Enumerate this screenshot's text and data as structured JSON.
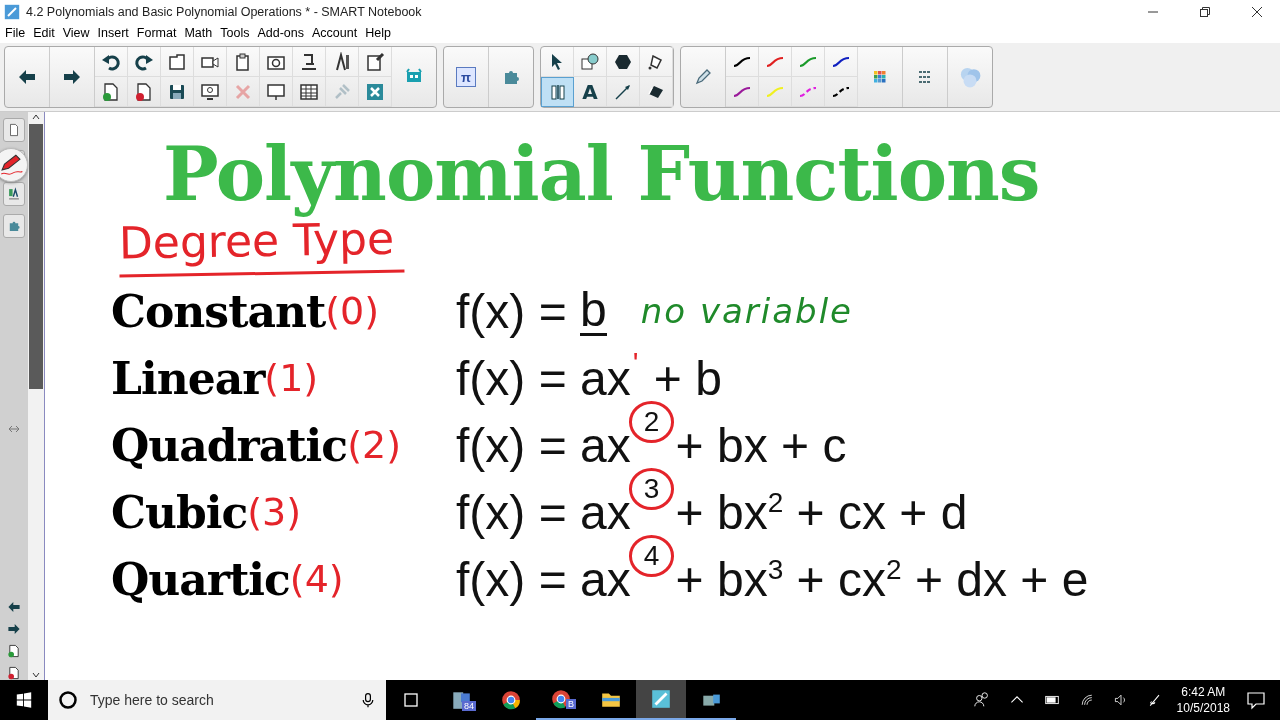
{
  "window": {
    "title": "4.2 Polynomials and Basic Polynomial Operations * - SMART Notebook"
  },
  "menu": [
    "File",
    "Edit",
    "View",
    "Insert",
    "Format",
    "Math",
    "Tools",
    "Add-ons",
    "Account",
    "Help"
  ],
  "actions": [
    {
      "disabled": false
    },
    {
      "disabled": false
    },
    {
      "disabled": false
    },
    {
      "disabled": false
    },
    {
      "disabled": false
    },
    {
      "disabled": false
    },
    {
      "disabled": false
    },
    {
      "disabled": false
    },
    {
      "disabled": false
    },
    {
      "disabled": false
    },
    {
      "disabled": false
    },
    {
      "disabled": false
    },
    {
      "disabled": false
    },
    {
      "disabled": true
    },
    {
      "disabled": false
    },
    {
      "disabled": false
    },
    {
      "disabled": true
    },
    {
      "disabled": false
    }
  ],
  "math_button": "π",
  "tools": [
    {
      "selected": false
    },
    {
      "selected": false
    },
    {
      "selected": false
    },
    {
      "selected": false
    },
    {
      "selected": true
    },
    {
      "selected": false,
      "label": "A"
    },
    {
      "selected": false
    },
    {
      "selected": false
    }
  ],
  "pens": [
    {
      "color": "#000000",
      "kind": "solid"
    },
    {
      "color": "#e02020",
      "kind": "solid"
    },
    {
      "color": "#1a9a2a",
      "kind": "solid"
    },
    {
      "color": "#1020c0",
      "kind": "solid"
    },
    {
      "color": "#9a1a9a",
      "kind": "solid"
    },
    {
      "color": "#f0f020",
      "kind": "solid"
    },
    {
      "color": "#e020e0",
      "kind": "dashed"
    },
    {
      "color": "#000000",
      "kind": "dashed"
    }
  ],
  "page": {
    "title": "Polynomial Functions",
    "header_ink": "Degree Type",
    "rows": [
      {
        "type": "Constant",
        "degree_ink": "(0)",
        "formula": [
          {
            "kind": "text",
            "text": "f(x) = "
          },
          {
            "kind": "underlined",
            "text": "b"
          }
        ],
        "note_ink": "no variable"
      },
      {
        "type": "Linear",
        "degree_ink": "(1)",
        "formula": [
          {
            "kind": "text",
            "text": "f(x) = ax"
          },
          {
            "kind": "ink_sup",
            "text": "'"
          },
          {
            "kind": "text",
            "text": " + b"
          }
        ]
      },
      {
        "type": "Quadratic",
        "degree_ink": "(2)",
        "formula": [
          {
            "kind": "text",
            "text": "f(x) = ax"
          },
          {
            "kind": "circled_sup",
            "text": "2"
          },
          {
            "kind": "text",
            "text": " + bx + c"
          }
        ]
      },
      {
        "type": "Cubic",
        "degree_ink": "(3)",
        "formula": [
          {
            "kind": "text",
            "text": "f(x) = ax"
          },
          {
            "kind": "circled_sup",
            "text": "3"
          },
          {
            "kind": "text",
            "text": " + bx$^{2}$ + cx + d"
          }
        ]
      },
      {
        "type": "Quartic",
        "degree_ink": "(4)",
        "formula": [
          {
            "kind": "text",
            "text": "f(x) = ax"
          },
          {
            "kind": "circled_sup",
            "text": "4"
          },
          {
            "kind": "text",
            "text": " + bx$^{3}$ + cx$^{2}$ + dx + e"
          }
        ]
      }
    ]
  },
  "taskbar": {
    "search": {
      "placeholder": "Type here to search"
    },
    "apps": [
      {
        "badge": "84",
        "running": false,
        "selected": false
      },
      {
        "running": false,
        "selected": false
      },
      {
        "badge": "B",
        "running": true,
        "selected": false
      },
      {
        "running": true,
        "selected": false
      },
      {
        "running": true,
        "selected": true
      },
      {
        "running": true,
        "selected": false
      }
    ],
    "time": "6:42 AM",
    "date": "10/5/2018"
  }
}
